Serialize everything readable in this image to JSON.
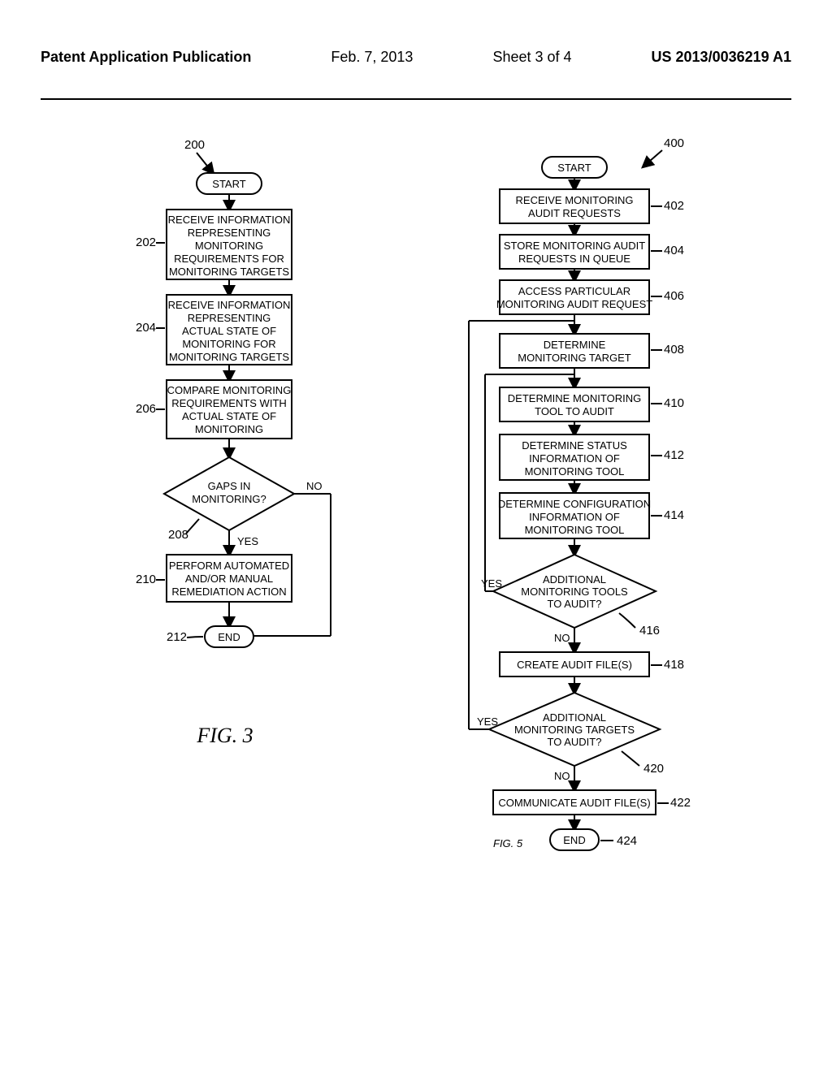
{
  "header": {
    "publication": "Patent Application Publication",
    "date": "Feb. 7, 2013",
    "sheet": "Sheet 3 of 4",
    "docnum": "US 2013/0036219 A1"
  },
  "fig3": {
    "ref": "200",
    "caption": "FIG. 3",
    "start": "START",
    "end": "END",
    "steps": {
      "202": {
        "ref": "202",
        "text": [
          "RECEIVE INFORMATION",
          "REPRESENTING",
          "MONITORING",
          "REQUIREMENTS FOR",
          "MONITORING TARGETS"
        ]
      },
      "204": {
        "ref": "204",
        "text": [
          "RECEIVE INFORMATION",
          "REPRESENTING",
          "ACTUAL STATE OF",
          "MONITORING FOR",
          "MONITORING TARGETS"
        ]
      },
      "206": {
        "ref": "206",
        "text": [
          "COMPARE MONITORING",
          "REQUIREMENTS WITH",
          "ACTUAL STATE OF",
          "MONITORING"
        ]
      },
      "208": {
        "ref": "208",
        "text": [
          "GAPS IN",
          "MONITORING?"
        ],
        "yes": "YES",
        "no": "NO"
      },
      "210": {
        "ref": "210",
        "text": [
          "PERFORM AUTOMATED",
          "AND/OR MANUAL",
          "REMEDIATION ACTION"
        ]
      },
      "212": {
        "ref": "212"
      }
    }
  },
  "fig5": {
    "ref": "400",
    "caption": "FIG. 5",
    "start": "START",
    "end": "END",
    "steps": {
      "402": {
        "ref": "402",
        "text": [
          "RECEIVE MONITORING",
          "AUDIT REQUESTS"
        ]
      },
      "404": {
        "ref": "404",
        "text": [
          "STORE MONITORING AUDIT",
          "REQUESTS IN QUEUE"
        ]
      },
      "406": {
        "ref": "406",
        "text": [
          "ACCESS PARTICULAR",
          "MONITORING AUDIT REQUEST"
        ]
      },
      "408": {
        "ref": "408",
        "text": [
          "DETERMINE",
          "MONITORING TARGET"
        ]
      },
      "410": {
        "ref": "410",
        "text": [
          "DETERMINE MONITORING",
          "TOOL TO AUDIT"
        ]
      },
      "412": {
        "ref": "412",
        "text": [
          "DETERMINE STATUS",
          "INFORMATION OF",
          "MONITORING TOOL"
        ]
      },
      "414": {
        "ref": "414",
        "text": [
          "DETERMINE CONFIGURATION",
          "INFORMATION OF",
          "MONITORING TOOL"
        ]
      },
      "416": {
        "ref": "416",
        "text": [
          "ADDITIONAL",
          "MONITORING TOOLS",
          "TO AUDIT?"
        ],
        "yes": "YES",
        "no": "NO"
      },
      "418": {
        "ref": "418",
        "text": [
          "CREATE AUDIT FILE(S)"
        ]
      },
      "420": {
        "ref": "420",
        "text": [
          "ADDITIONAL",
          "MONITORING TARGETS",
          "TO AUDIT?"
        ],
        "yes": "YES",
        "no": "NO"
      },
      "422": {
        "ref": "422",
        "text": [
          "COMMUNICATE AUDIT FILE(S)"
        ]
      },
      "424": {
        "ref": "424"
      }
    }
  }
}
